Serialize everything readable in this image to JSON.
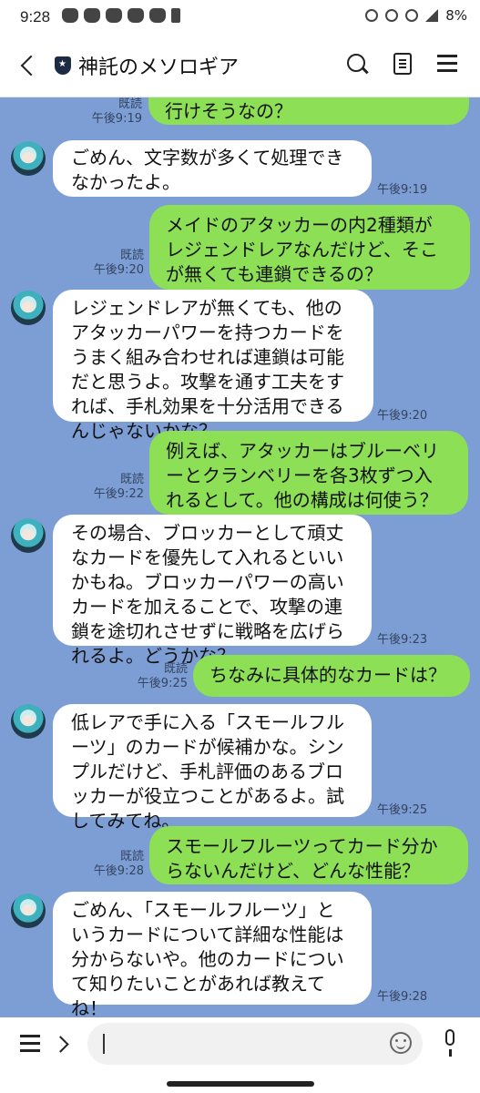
{
  "status_bar": {
    "time": "9:28",
    "battery": "8%"
  },
  "header": {
    "title": "神託のメソロギア"
  },
  "messages": [
    {
      "id": "m0",
      "side": "me",
      "text": "レジェンドレアが無くても、そこが無くても行けそうなの？",
      "visible_text": "行けそうなの？",
      "read": "既読",
      "time": "午後9:19"
    },
    {
      "id": "m1",
      "side": "bot",
      "lines": [
        "ごめん、文字数が多くて処理でき",
        "なかったよ。"
      ],
      "time": "午後9:19"
    },
    {
      "id": "m2",
      "side": "me",
      "lines": [
        "メイドのアタッカーの内2種類が",
        "レジェンドレアなんだけど、そこ",
        "が無くても連鎖できるの？"
      ],
      "read": "既読",
      "time": "午後9:20"
    },
    {
      "id": "m3",
      "side": "bot",
      "lines": [
        "レジェンドレアが無くても、他の",
        "アタッカーパワーを持つカードを",
        "うまく組み合わせれば連鎖は可能",
        "だと思うよ。攻撃を通す工夫をす",
        "れば、手札効果を十分活用できる",
        "んじゃないかな？"
      ],
      "time": "午後9:20"
    },
    {
      "id": "m4",
      "side": "me",
      "lines": [
        "例えば、アタッカーはブルーベリ",
        "ーとクランベリーを各3枚ずつ入",
        "れるとして。他の構成は何使う？"
      ],
      "read": "既読",
      "time": "午後9:22"
    },
    {
      "id": "m5",
      "side": "bot",
      "lines": [
        "その場合、ブロッカーとして頑丈",
        "なカードを優先して入れるといい",
        "かもね。ブロッカーパワーの高い",
        "カードを加えることで、攻撃の連",
        "鎖を途切れさせずに戦略を広げら",
        "れるよ。どうかな？"
      ],
      "time": "午後9:23"
    },
    {
      "id": "m6",
      "side": "me",
      "lines": [
        "ちなみに具体的なカードは？"
      ],
      "read": "既読",
      "time": "午後9:25"
    },
    {
      "id": "m7",
      "side": "bot",
      "lines": [
        "低レアで手に入る「スモールフル",
        "ーツ」のカードが候補かな。シン",
        "プルだけど、手札評価のあるブロ",
        "ッカーが役立つことがあるよ。試",
        "してみてね。"
      ],
      "time": "午後9:25"
    },
    {
      "id": "m8",
      "side": "me",
      "lines": [
        "スモールフルーツってカード分か",
        "らないんだけど、どんな性能？"
      ],
      "read": "既読",
      "time": "午後9:28"
    },
    {
      "id": "m9",
      "side": "bot",
      "lines": [
        "ごめん、「スモールフルーツ」と",
        "いうカードについて詳細な性能は",
        "分からないや。他のカードについ",
        "て知りたいことがあれば教えて",
        "ね！"
      ],
      "time": "午後9:28"
    }
  ],
  "input": {
    "placeholder": ""
  }
}
